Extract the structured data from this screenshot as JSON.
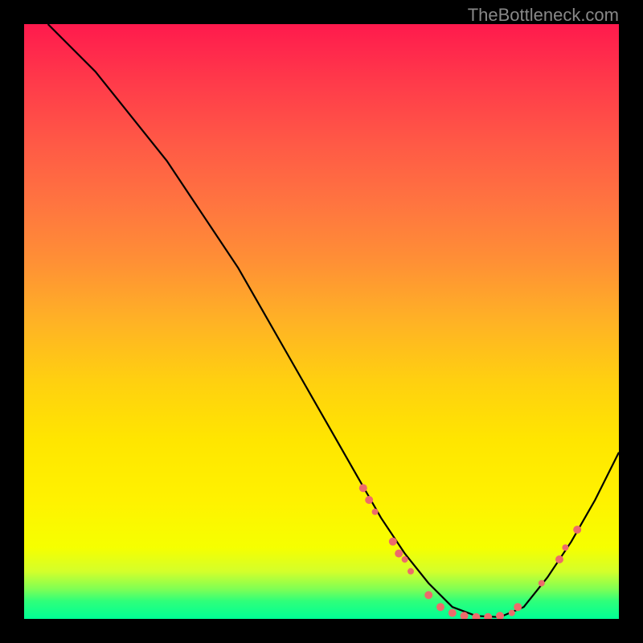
{
  "watermark": "TheBottleneck.com",
  "chart_data": {
    "type": "line",
    "title": "",
    "xlabel": "",
    "ylabel": "",
    "xlim": [
      0,
      100
    ],
    "ylim": [
      0,
      100
    ],
    "series": [
      {
        "name": "curve",
        "x": [
          4,
          8,
          12,
          16,
          20,
          24,
          28,
          32,
          36,
          40,
          44,
          48,
          52,
          56,
          60,
          64,
          68,
          72,
          76,
          80,
          84,
          88,
          92,
          96,
          100
        ],
        "y": [
          100,
          96,
          92,
          87,
          82,
          77,
          71,
          65,
          59,
          52,
          45,
          38,
          31,
          24,
          17,
          11,
          6,
          2,
          0.5,
          0.3,
          2,
          7,
          13,
          20,
          28
        ]
      }
    ],
    "markers": [
      {
        "x": 57,
        "y": 22,
        "r": 5
      },
      {
        "x": 58,
        "y": 20,
        "r": 5
      },
      {
        "x": 59,
        "y": 18,
        "r": 4
      },
      {
        "x": 62,
        "y": 13,
        "r": 5
      },
      {
        "x": 63,
        "y": 11,
        "r": 5
      },
      {
        "x": 64,
        "y": 10,
        "r": 4
      },
      {
        "x": 65,
        "y": 8,
        "r": 4
      },
      {
        "x": 68,
        "y": 4,
        "r": 5
      },
      {
        "x": 70,
        "y": 2,
        "r": 5
      },
      {
        "x": 72,
        "y": 1,
        "r": 5
      },
      {
        "x": 74,
        "y": 0.5,
        "r": 5
      },
      {
        "x": 76,
        "y": 0.3,
        "r": 5
      },
      {
        "x": 78,
        "y": 0.3,
        "r": 5
      },
      {
        "x": 80,
        "y": 0.5,
        "r": 5
      },
      {
        "x": 82,
        "y": 1,
        "r": 4
      },
      {
        "x": 83,
        "y": 2,
        "r": 5
      },
      {
        "x": 87,
        "y": 6,
        "r": 4
      },
      {
        "x": 90,
        "y": 10,
        "r": 5
      },
      {
        "x": 91,
        "y": 12,
        "r": 4
      },
      {
        "x": 93,
        "y": 15,
        "r": 5
      }
    ],
    "gradient_stops": [
      {
        "pos": 0,
        "color": "#ff1a4d"
      },
      {
        "pos": 50,
        "color": "#ffb225"
      },
      {
        "pos": 80,
        "color": "#fff200"
      },
      {
        "pos": 100,
        "color": "#00ff95"
      }
    ]
  }
}
